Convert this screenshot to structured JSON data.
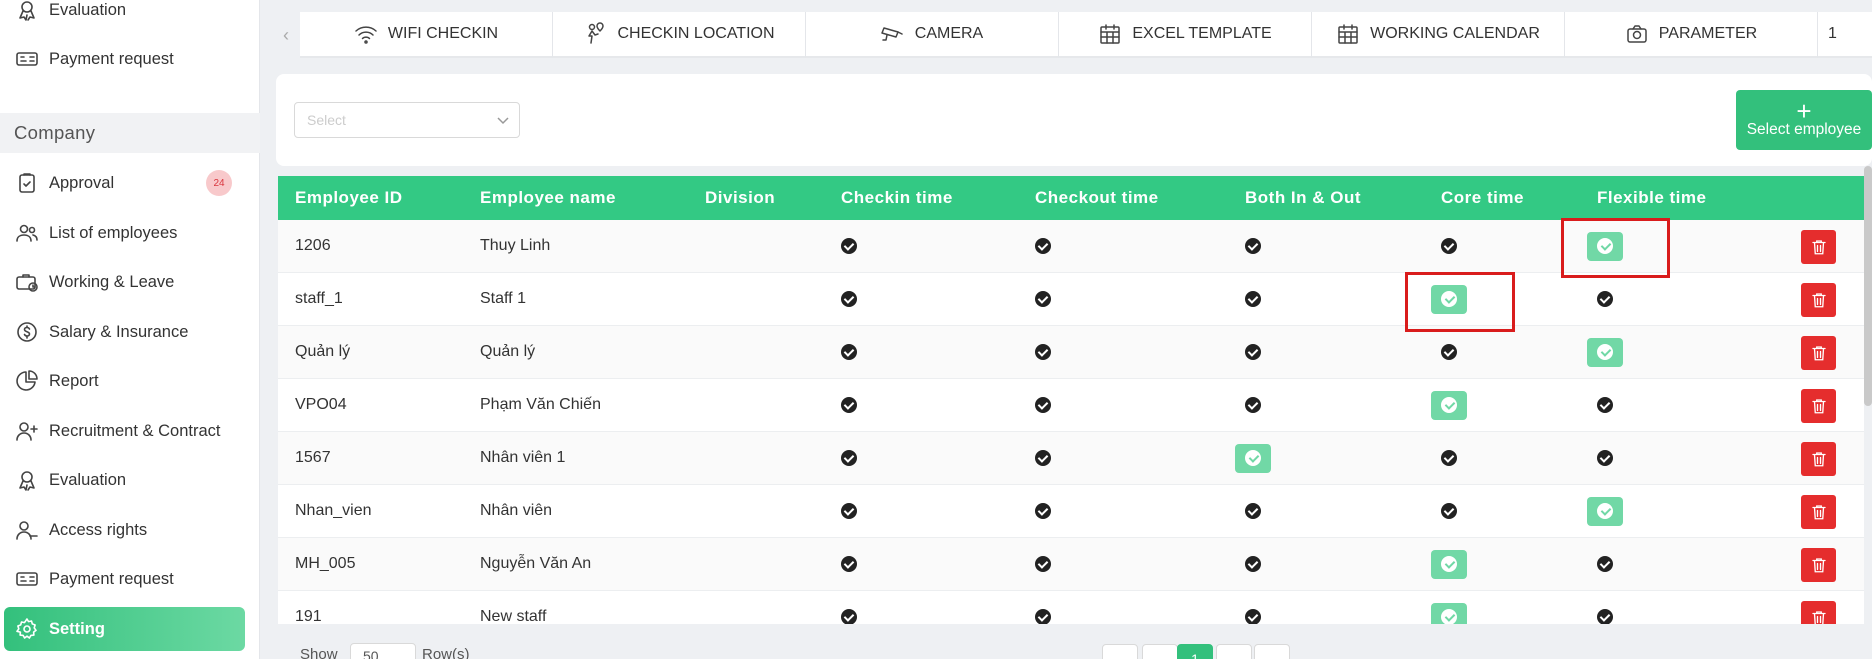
{
  "sidebar": {
    "top_items": [
      {
        "label": "Evaluation",
        "icon": "evaluation-icon"
      },
      {
        "label": "Payment request",
        "icon": "payment-icon"
      }
    ],
    "section_title": "Company",
    "items": [
      {
        "label": "Approval",
        "icon": "approval-icon",
        "badge": "24"
      },
      {
        "label": "List of employees",
        "icon": "employees-icon"
      },
      {
        "label": "Working & Leave",
        "icon": "working-leave-icon"
      },
      {
        "label": "Salary & Insurance",
        "icon": "salary-icon"
      },
      {
        "label": "Report",
        "icon": "report-icon"
      },
      {
        "label": "Recruitment & Contract",
        "icon": "recruitment-icon"
      },
      {
        "label": "Evaluation",
        "icon": "evaluation-icon"
      },
      {
        "label": "Access rights",
        "icon": "access-rights-icon"
      },
      {
        "label": "Payment request",
        "icon": "payment-icon"
      },
      {
        "label": "Setting",
        "icon": "gear-icon",
        "active": true
      }
    ]
  },
  "tabs": {
    "prev_arrow": "‹",
    "items": [
      {
        "label": "WIFI CHECKIN",
        "icon": "wifi-icon"
      },
      {
        "label": "CHECKIN LOCATION",
        "icon": "location-icon"
      },
      {
        "label": "CAMERA",
        "icon": "camera-icon"
      },
      {
        "label": "EXCEL TEMPLATE",
        "icon": "calendar-icon"
      },
      {
        "label": "WORKING CALENDAR",
        "icon": "calendar-icon"
      },
      {
        "label": "PARAMETER",
        "icon": "camera-icon"
      },
      {
        "label": "1"
      }
    ]
  },
  "filter": {
    "select_placeholder": "Select",
    "select_employee_label": "Select employee",
    "plus": "+"
  },
  "table": {
    "headers": [
      "Employee ID",
      "Employee name",
      "Division",
      "Checkin time",
      "Checkout time",
      "Both In & Out",
      "Core time",
      "Flexible time"
    ],
    "rows": [
      {
        "id": "1206",
        "name": "Thuy Linh",
        "division": "",
        "selected": "Flexible time"
      },
      {
        "id": "staff_1",
        "name": "Staff 1",
        "division": "",
        "selected": "Core time"
      },
      {
        "id": "Quản lý",
        "name": "Quản lý",
        "division": "",
        "selected": "Flexible time"
      },
      {
        "id": "VPO04",
        "name": "Phạm Văn Chiến",
        "division": "",
        "selected": "Core time"
      },
      {
        "id": "1567",
        "name": "Nhân viên 1",
        "division": "",
        "selected": "Both In & Out"
      },
      {
        "id": "Nhan_vien",
        "name": "Nhân viên",
        "division": "",
        "selected": "Flexible time"
      },
      {
        "id": "MH_005",
        "name": "Nguyễn Văn An",
        "division": "",
        "selected": "Core time"
      },
      {
        "id": "191",
        "name": "New staff",
        "division": "",
        "selected": "Core time"
      }
    ]
  },
  "footer": {
    "show_label": "Show",
    "page_size": "50",
    "rows_label": "Row(s)",
    "current_page": "1"
  },
  "colors": {
    "accent": "#33c07c",
    "header": "#33c984",
    "selected_check": "#71d8a6",
    "delete": "#e52d2d",
    "highlight_box": "#d91c1c"
  }
}
